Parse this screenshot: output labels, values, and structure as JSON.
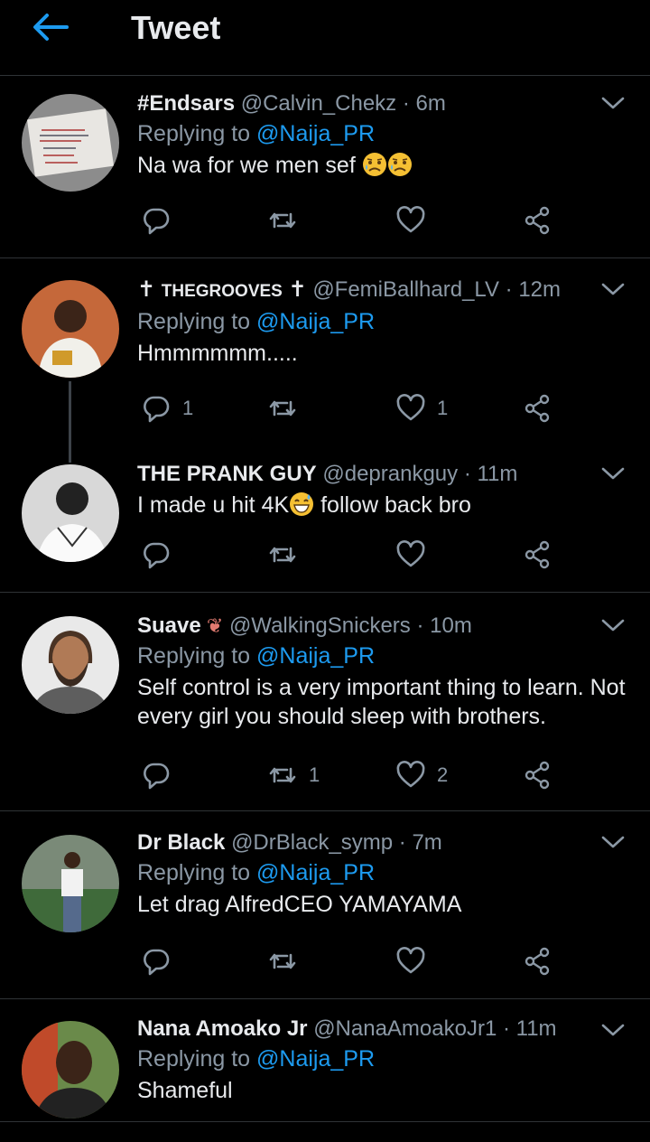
{
  "header": {
    "title": "Tweet"
  },
  "tweets": [
    {
      "name": "#Endsars",
      "handle": "@Calvin_Chekz",
      "time": "· 6m",
      "replying_prefix": "Replying to",
      "replying_to": "@Naija_PR",
      "text": "Na wa for we men sef",
      "emoji": [
        "sad-sweat",
        "sad-sweat"
      ],
      "replies": "",
      "retweets": "",
      "likes": ""
    },
    {
      "name": "THEGROOVES",
      "name_cross": "✝",
      "handle": "@FemiBallhard_LV",
      "time": "· 12m",
      "replying_prefix": "Replying to",
      "replying_to": "@Naija_PR",
      "text": "Hmmmmmm.....",
      "replies": "1",
      "retweets": "",
      "likes": "1"
    },
    {
      "name": "THE PRANK GUY",
      "handle": "@deprankguy",
      "time": "· 11m",
      "text_before": "I made u hit 4K",
      "text_after": " follow back bro",
      "emoji": [
        "grin-sweat"
      ],
      "replies": "",
      "retweets": "",
      "likes": ""
    },
    {
      "name": "Suave",
      "handle": "@WalkingSnickers",
      "time": "· 10m",
      "replying_prefix": "Replying to",
      "replying_to": "@Naija_PR",
      "text": "Self control is a very important thing to learn. Not every girl you should sleep with brothers.",
      "replies": "",
      "retweets": "1",
      "likes": "2"
    },
    {
      "name": "Dr Black",
      "handle": "@DrBlack_symp",
      "time": "· 7m",
      "replying_prefix": "Replying to",
      "replying_to": "@Naija_PR",
      "text": "Let drag AlfredCEO YAMAYAMA",
      "replies": "",
      "retweets": "",
      "likes": ""
    },
    {
      "name": "Nana Amoako Jr",
      "handle": "@NanaAmoakoJr1",
      "time": "· 11m",
      "replying_prefix": "Replying to",
      "replying_to": "@Naija_PR",
      "text": "Shameful"
    }
  ],
  "colors": {
    "accent": "#1d9bf0",
    "muted": "#8b98a5",
    "background": "#000000",
    "divider": "#2f3336"
  }
}
